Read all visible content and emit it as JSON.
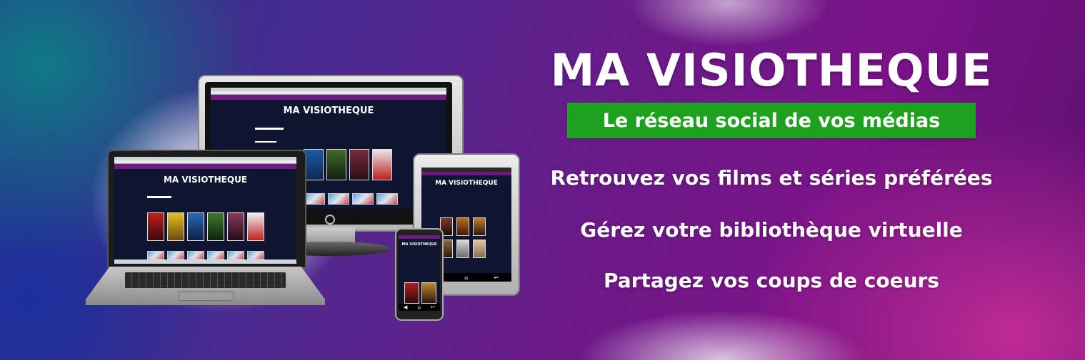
{
  "banner": {
    "headline": "MA VISIOTHEQUE",
    "tagline": "Le réseau social de vos médias",
    "features": [
      "Retrouvez vos films et séries préférées",
      "Gérez votre bibliothèque virtuelle",
      "Partagez vos coups de coeurs"
    ]
  },
  "devices": {
    "site_title": "MA VISIOTHEQUE"
  },
  "colors": {
    "tagline_bg": "#1ea11e",
    "nav_purple": "#6d1b7f",
    "screen_bg": "#0f1530"
  }
}
